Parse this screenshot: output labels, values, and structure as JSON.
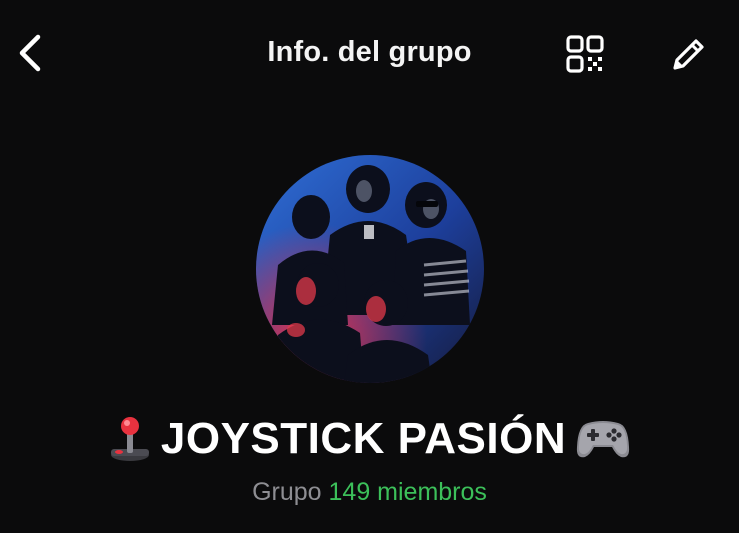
{
  "header": {
    "title": "Info. del grupo",
    "back_icon": "chevron-left-icon",
    "qr_icon": "qr-code-icon",
    "edit_icon": "pencil-icon"
  },
  "group": {
    "name": "JOYSTICK PASIÓN",
    "leading_emoji": "joystick-icon",
    "trailing_emoji": "game-controller-icon",
    "type_label": "Grupo",
    "members_label": "149 miembros"
  },
  "colors": {
    "background": "#0b0b0c",
    "text": "#ffffff",
    "muted": "#8e8e93",
    "accent_green": "#3cc05a"
  }
}
